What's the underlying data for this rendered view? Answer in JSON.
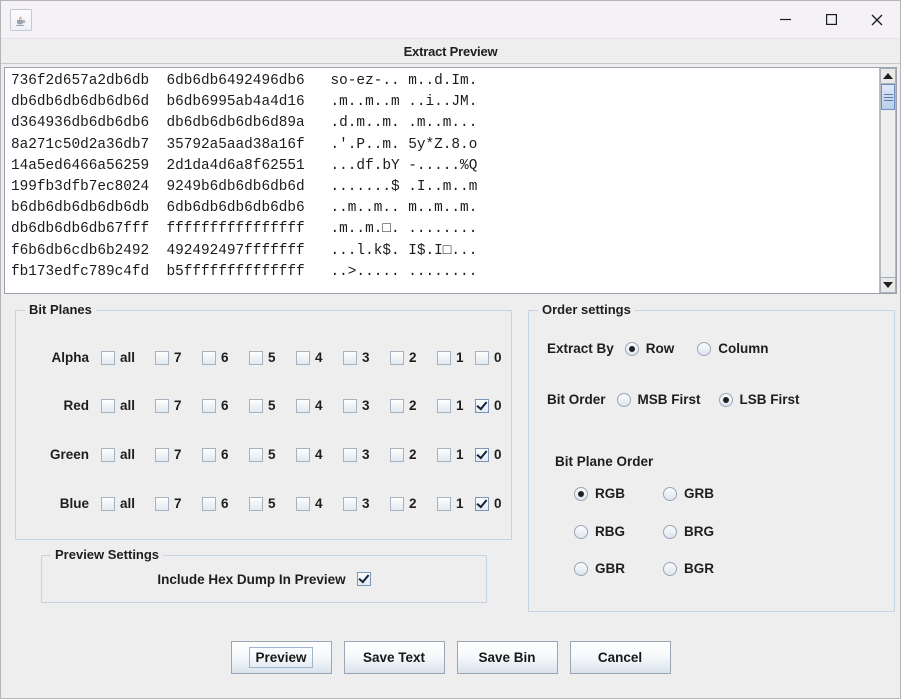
{
  "window": {
    "app_icon": "java-coffee-cup-icon",
    "minimize_label": "–",
    "maximize_label": "□",
    "close_label": "X"
  },
  "dialog": {
    "title": "Extract Preview"
  },
  "hex_preview": {
    "lines": [
      "736f2d657a2db6db  6db6db6492496db6   so-ez-.. m..d.Im.",
      "db6db6db6db6db6d  b6db6995ab4a4d16   .m..m..m ..i..JM.",
      "d364936db6db6db6  db6db6db6db6d89a   .d.m..m. .m..m...",
      "8a271c50d2a36db7  35792a5aad38a16f   .'.P..m. 5y*Z.8.o",
      "14a5ed6466a56259  2d1da4d6a8f62551   ...df.bY -.....%Q",
      "199fb3dfb7ec8024  9249b6db6db6db6d   .......$ .I..m..m",
      "b6db6db6db6db6db  6db6db6db6db6db6   ..m..m.. m..m..m.",
      "db6db6db6db67fff  ffffffffffffffff   .m..m.□. ........",
      "f6b6db6cdb6b2492  492492497fffffff   ...l.k$. I$.I□...",
      "fb173edfc789c4fd  b5ffffffffffffff   ..>..... ........"
    ]
  },
  "bit_planes": {
    "legend": "Bit Planes",
    "bit_labels": [
      "all",
      "7",
      "6",
      "5",
      "4",
      "3",
      "2",
      "1",
      "0"
    ],
    "rows": [
      {
        "channel": "Alpha",
        "checked": [
          false,
          false,
          false,
          false,
          false,
          false,
          false,
          false,
          false
        ]
      },
      {
        "channel": "Red",
        "checked": [
          false,
          false,
          false,
          false,
          false,
          false,
          false,
          false,
          true
        ]
      },
      {
        "channel": "Green",
        "checked": [
          false,
          false,
          false,
          false,
          false,
          false,
          false,
          false,
          true
        ]
      },
      {
        "channel": "Blue",
        "checked": [
          false,
          false,
          false,
          false,
          false,
          false,
          false,
          false,
          true
        ]
      }
    ]
  },
  "order_settings": {
    "legend": "Order settings",
    "extract_by": {
      "label": "Extract By",
      "options": [
        "Row",
        "Column"
      ],
      "selected": "Row"
    },
    "bit_order": {
      "label": "Bit Order",
      "options": [
        "MSB First",
        "LSB First"
      ],
      "selected": "LSB First"
    },
    "bit_plane_order": {
      "label": "Bit Plane Order",
      "options": [
        "RGB",
        "GRB",
        "RBG",
        "BRG",
        "GBR",
        "BGR"
      ],
      "selected": "RGB"
    }
  },
  "preview_settings": {
    "legend": "Preview Settings",
    "include_hex_dump": {
      "label": "Include Hex Dump In Preview",
      "checked": true
    }
  },
  "buttons": {
    "preview": "Preview",
    "save_text": "Save Text",
    "save_bin": "Save Bin",
    "cancel": "Cancel"
  },
  "colors": {
    "dialog_bg": "#eeeeee",
    "titlebar_bg": "#f4f2f7",
    "group_border": "#c5d3e2",
    "text": "#1e1e1e",
    "scroll_thumb": "#b9cdea"
  }
}
